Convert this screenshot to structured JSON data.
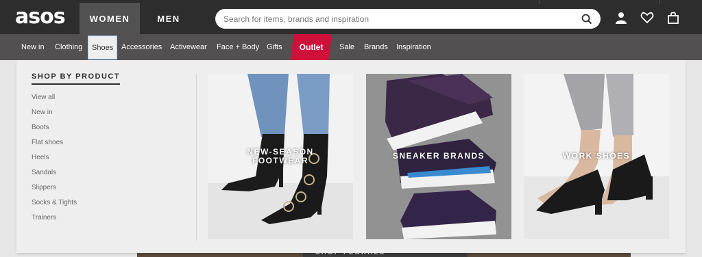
{
  "header": {
    "logo": "asos",
    "gender_tabs": [
      {
        "label": "WOMEN",
        "active": true
      },
      {
        "label": "MEN",
        "active": false
      }
    ],
    "search": {
      "placeholder": "Search for items, brands and inspiration",
      "value": ""
    },
    "icons": [
      "search-icon",
      "account-icon",
      "heart-icon",
      "bag-icon"
    ]
  },
  "nav": {
    "items": [
      "New in",
      "Clothing",
      "Shoes",
      "Accessories",
      "Activewear",
      "Face + Body",
      "Gifts",
      "Outlet",
      "Sale",
      "Brands",
      "Inspiration"
    ],
    "active": "Shoes",
    "highlight": "Outlet",
    "highlight_color": "#d0103a"
  },
  "dropdown": {
    "section_title": "SHOP BY PRODUCT",
    "links": [
      "View all",
      "New in",
      "Boots",
      "Flat shoes",
      "Heels",
      "Sandals",
      "Slippers",
      "Socks & Tights",
      "Trainers"
    ],
    "tiles": [
      {
        "label": "NEW-SEASON\nFOOTWEAR"
      },
      {
        "label": "SNEAKER BRANDS"
      },
      {
        "label": "WORK SHOES"
      }
    ]
  },
  "background": {
    "banner_text": "SHOP FLORALS"
  },
  "colors": {
    "top_bar": "#2d2d2d",
    "nav_bar": "#525050",
    "active_tab": "#525252"
  }
}
